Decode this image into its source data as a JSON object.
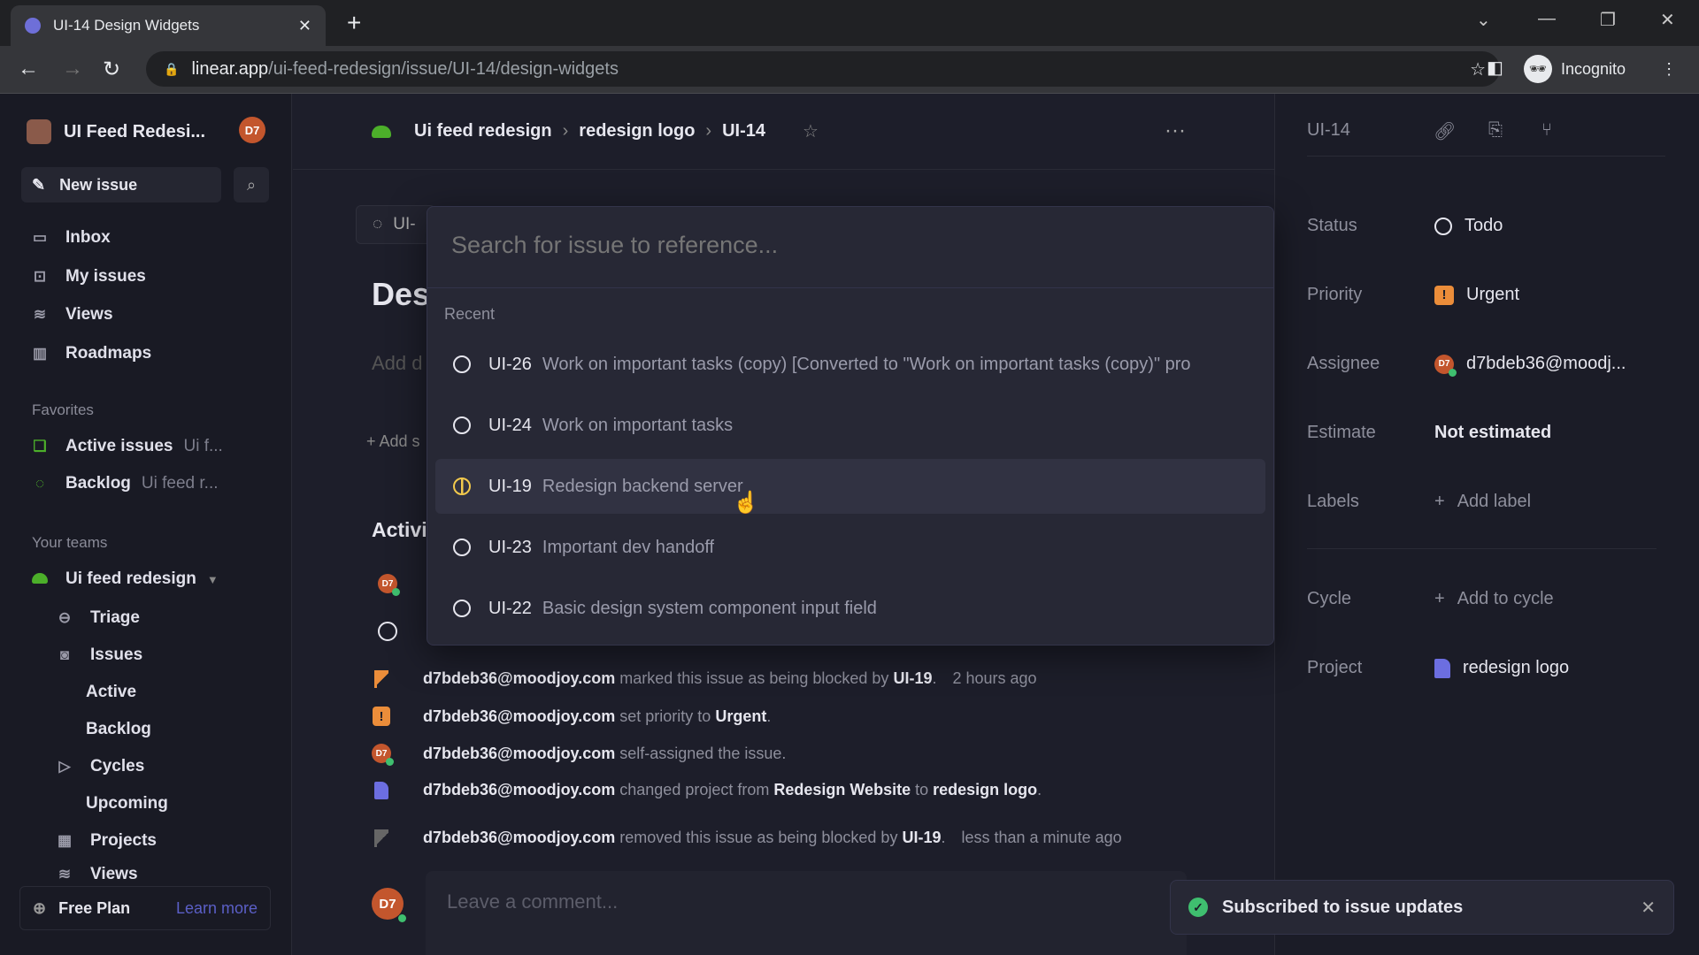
{
  "browser": {
    "tab_title": "UI-14 Design Widgets",
    "url_host": "linear.app",
    "url_path": "/ui-feed-redesign/issue/UI-14/design-widgets",
    "profile": "Incognito"
  },
  "sidebar": {
    "workspace": "UI Feed Redesi...",
    "avatar": "D7",
    "new_issue": "New issue",
    "nav": [
      {
        "label": "Inbox",
        "icon": "inbox-icon"
      },
      {
        "label": "My issues",
        "icon": "my-issues-icon"
      },
      {
        "label": "Views",
        "icon": "layers-icon"
      },
      {
        "label": "Roadmaps",
        "icon": "map-icon"
      }
    ],
    "favorites_heading": "Favorites",
    "favorites": [
      {
        "label": "Active issues",
        "sub": "Ui f..."
      },
      {
        "label": "Backlog",
        "sub": "Ui feed r..."
      }
    ],
    "teams_heading": "Your teams",
    "team": "Ui feed redesign",
    "team_items": [
      "Triage",
      "Issues",
      "Active",
      "Backlog",
      "Cycles",
      "Upcoming",
      "Projects",
      "Views"
    ],
    "free_plan": "Free Plan",
    "learn_more": "Learn more"
  },
  "header": {
    "breadcrumb": [
      "Ui feed redesign",
      "redesign logo",
      "UI-14"
    ]
  },
  "issue": {
    "chip": "UI-",
    "title": "Des",
    "add_description": "Add d",
    "add_sub": "+ Add s",
    "activity_heading": "Activi"
  },
  "modal": {
    "placeholder": "Search for issue to reference...",
    "recent_label": "Recent",
    "items": [
      {
        "id": "UI-26",
        "title": "Work on important tasks (copy) [Converted to \"Work on important tasks (copy)\" pro",
        "status": "todo"
      },
      {
        "id": "UI-24",
        "title": "Work on important tasks",
        "status": "todo"
      },
      {
        "id": "UI-19",
        "title": "Redesign backend server",
        "status": "in-progress"
      },
      {
        "id": "UI-23",
        "title": "Important dev handoff",
        "status": "todo"
      },
      {
        "id": "UI-22",
        "title": "Basic design system component input field",
        "status": "todo"
      }
    ]
  },
  "activity": [
    {
      "user": "d7bdeb36@moodjoy.com",
      "text": "marked this issue as being blocked by",
      "ref": "UI-19",
      "time": "2 hours ago"
    },
    {
      "user": "d7bdeb36@moodjoy.com",
      "text": "set priority to",
      "ref": "Urgent"
    },
    {
      "user": "d7bdeb36@moodjoy.com",
      "text": "self-assigned the issue."
    },
    {
      "user": "d7bdeb36@moodjoy.com",
      "text": "changed project from",
      "ref": "Redesign Website",
      "text2": "to",
      "ref2": "redesign logo"
    },
    {
      "user": "d7bdeb36@moodjoy.com",
      "text": "removed this issue as being blocked by",
      "ref": "UI-19",
      "time": "less than a minute ago"
    }
  ],
  "comment_placeholder": "Leave a comment...",
  "details": {
    "id": "UI-14",
    "status_label": "Status",
    "status": "Todo",
    "priority_label": "Priority",
    "priority": "Urgent",
    "assignee_label": "Assignee",
    "assignee": "d7bdeb36@moodj...",
    "estimate_label": "Estimate",
    "estimate": "Not estimated",
    "labels_label": "Labels",
    "add_label": "Add label",
    "cycle_label": "Cycle",
    "add_cycle": "Add to cycle",
    "project_label": "Project",
    "project": "redesign logo"
  },
  "toast": "Subscribed to issue updates",
  "colors": {
    "accent": "#5b5fc7",
    "urgent": "#eb8d3a",
    "in_progress": "#f2c94c",
    "team": "#4caf2a",
    "online": "#3fbf6f"
  }
}
